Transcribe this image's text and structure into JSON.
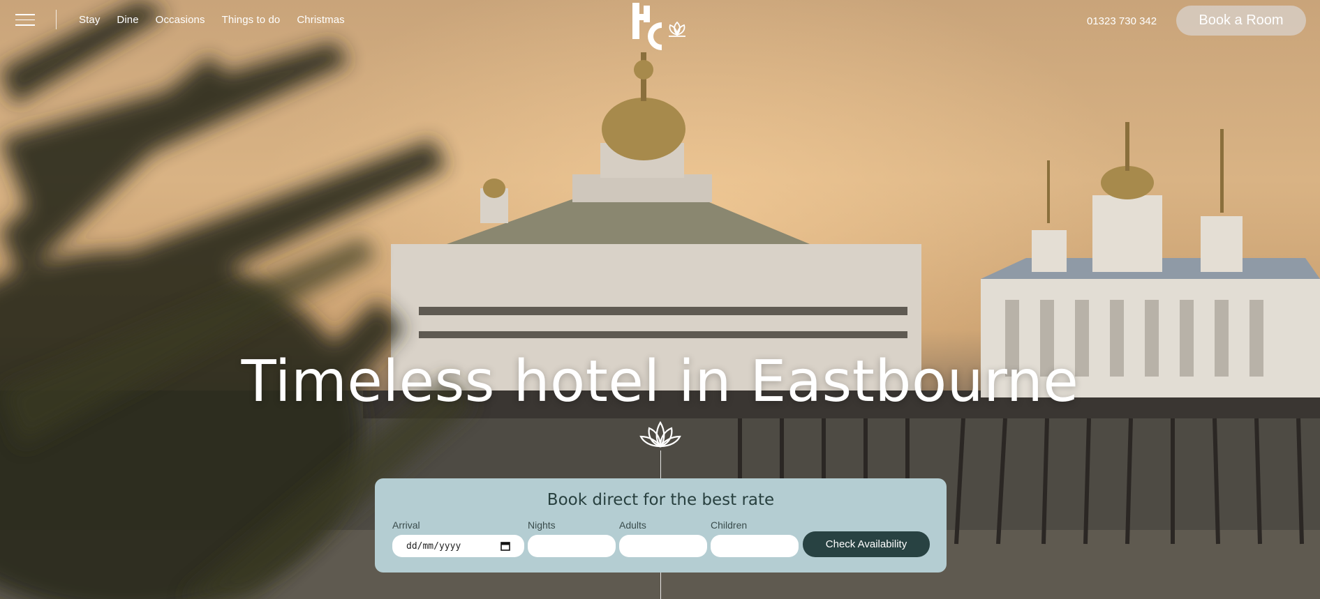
{
  "nav": {
    "menu_icon": "hamburger-menu-icon",
    "items": [
      {
        "label": "Stay"
      },
      {
        "label": "Dine"
      },
      {
        "label": "Occasions"
      },
      {
        "label": "Things to do"
      },
      {
        "label": "Christmas"
      }
    ],
    "phone": "01323 730 342",
    "book_label": "Book a Room"
  },
  "logo": {
    "text": "HC",
    "icon": "lotus-icon"
  },
  "hero": {
    "headline": "Timeless hotel in Eastbourne",
    "divider_icon": "lotus-icon"
  },
  "booking": {
    "title": "Book direct for the best rate",
    "arrival_label": "Arrival",
    "arrival_placeholder": "dd/mm/yyyy",
    "nights_label": "Nights",
    "adults_label": "Adults",
    "children_label": "Children",
    "submit_label": "Check Availability"
  },
  "colors": {
    "booking_panel": "#b4cdd2",
    "button_dark": "#284242",
    "book_room_button": "#d7cdc3"
  }
}
